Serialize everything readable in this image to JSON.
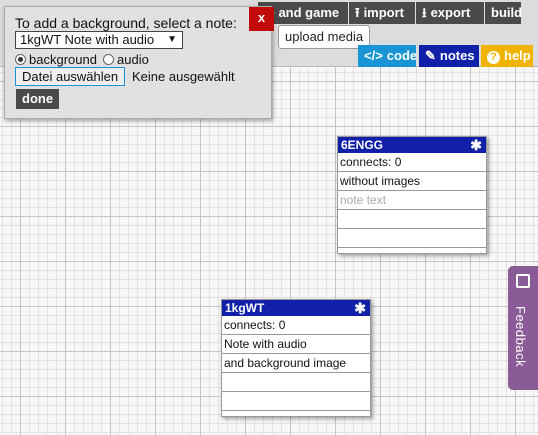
{
  "toolbar": {
    "handle_game_label": "le and game",
    "import_label": "import",
    "export_label": "export",
    "build_label": "build",
    "upload_media_label": "upload media",
    "code_label": "code",
    "notes_label": "notes",
    "help_label": "help"
  },
  "icons": {
    "import": "upload-icon",
    "export": "download-icon",
    "code": "code-icon",
    "notes": "pencil-icon",
    "help": "question-icon",
    "note_star": "star-icon",
    "feedback": "megaphone-icon"
  },
  "colors": {
    "toolbar_button": "#4a4a4a",
    "code_button": "#1994d5",
    "notes_button": "#1020a8",
    "help_button": "#f0b400",
    "note_header": "#1020a8",
    "close_button": "#c10b0b",
    "feedback_tab": "#8a5b96"
  },
  "dialog": {
    "close_label": "x",
    "prompt": "To add a background, select a note:",
    "selected_note": "1kgWT Note with audio",
    "radio_background": "background",
    "radio_audio": "audio",
    "radio_selected": "background",
    "file_button": "Datei auswählen",
    "file_status": "Keine ausgewählt",
    "done_label": "done"
  },
  "notes": [
    {
      "id": "6ENGG",
      "rows": [
        "connects: 0",
        "without images",
        "note text",
        "",
        "",
        ""
      ]
    },
    {
      "id": "1kgWT",
      "rows": [
        "connects: 0",
        "Note with audio",
        "and background image",
        "",
        "",
        ""
      ]
    }
  ],
  "feedback": {
    "label": "Feedback"
  }
}
